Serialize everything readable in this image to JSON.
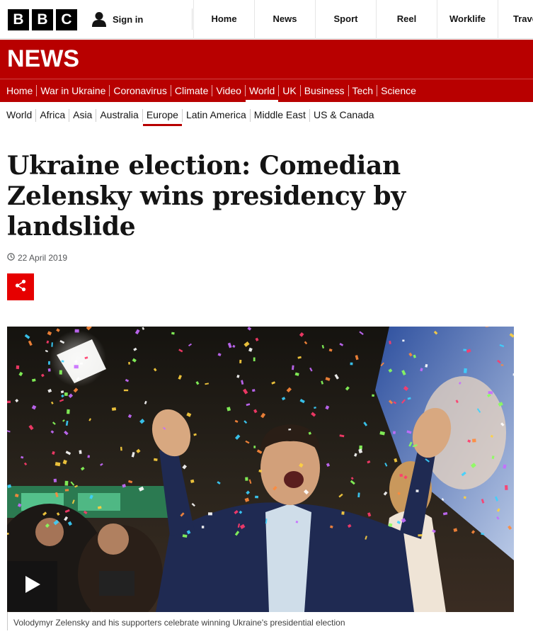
{
  "brand": {
    "letters": [
      "B",
      "B",
      "C"
    ]
  },
  "account": {
    "signin_label": "Sign in"
  },
  "global_nav": [
    "Home",
    "News",
    "Sport",
    "Reel",
    "Worklife",
    "Travel"
  ],
  "news_header": {
    "wordmark": "NEWS"
  },
  "section_nav": [
    "Home",
    "War in Ukraine",
    "Coronavirus",
    "Climate",
    "Video",
    "World",
    "UK",
    "Business",
    "Tech",
    "Science"
  ],
  "section_nav_active": "World",
  "sub_nav": [
    "World",
    "Africa",
    "Asia",
    "Australia",
    "Europe",
    "Latin America",
    "Middle East",
    "US & Canada"
  ],
  "sub_nav_active": "Europe",
  "article": {
    "headline": "Ukraine election: Comedian Zelensky wins presidency by landslide",
    "date": "22 April 2019",
    "caption": "Volodymyr Zelensky and his supporters celebrate winning Ukraine's presidential election"
  },
  "icons": {
    "user": "user-icon",
    "clock": "clock-icon",
    "share": "share-icon",
    "play": "play-icon"
  },
  "colors": {
    "news_red": "#b80000",
    "share_red": "#e60000",
    "brand_black": "#000000"
  }
}
